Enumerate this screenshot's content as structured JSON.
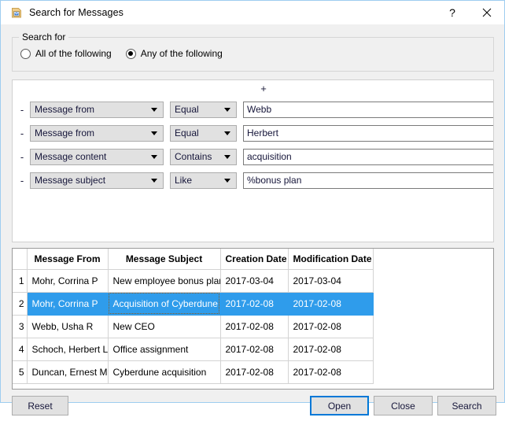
{
  "window": {
    "title": "Search for Messages",
    "icon": "message-document-icon",
    "help_label": "?",
    "close_label": "✕",
    "border_color": "#9ecdf0",
    "accent_color": "#0078d7",
    "selection_color": "#2f9ceb"
  },
  "search_for_group": {
    "legend": "Search for",
    "options": [
      {
        "label": "All of the following",
        "checked": false
      },
      {
        "label": "Any of the following",
        "checked": true
      }
    ]
  },
  "criteria": {
    "add_label": "+",
    "remove_label": "-",
    "rows": [
      {
        "field": "Message from",
        "operator": "Equal",
        "value": "Webb"
      },
      {
        "field": "Message from",
        "operator": "Equal",
        "value": "Herbert"
      },
      {
        "field": "Message content",
        "operator": "Contains",
        "value": "acquisition"
      },
      {
        "field": "Message subject",
        "operator": "Like",
        "value": "%bonus plan"
      }
    ]
  },
  "results": {
    "columns": [
      "",
      "Message From",
      "Message Subject",
      "Creation Date",
      "Modification Date"
    ],
    "rows": [
      {
        "num": "1",
        "from": "Mohr, Corrina P",
        "subject": "New employee bonus plan",
        "creation": "2017-03-04",
        "modification": "2017-03-04",
        "selected": false,
        "focused_cell": false
      },
      {
        "num": "2",
        "from": "Mohr, Corrina P",
        "subject": "Acquisition of Cyberdune",
        "creation": "2017-02-08",
        "modification": "2017-02-08",
        "selected": true,
        "focused_cell": true
      },
      {
        "num": "3",
        "from": "Webb, Usha R",
        "subject": "New CEO",
        "creation": "2017-02-08",
        "modification": "2017-02-08",
        "selected": false,
        "focused_cell": false
      },
      {
        "num": "4",
        "from": "Schoch, Herbert L",
        "subject": "Office assignment",
        "creation": "2017-02-08",
        "modification": "2017-02-08",
        "selected": false,
        "focused_cell": false
      },
      {
        "num": "5",
        "from": "Duncan, Ernest M",
        "subject": "Cyberdune acquisition",
        "creation": "2017-02-08",
        "modification": "2017-02-08",
        "selected": false,
        "focused_cell": false
      }
    ]
  },
  "footer": {
    "reset_label": "Reset",
    "open_label": "Open",
    "close_label": "Close",
    "search_label": "Search"
  }
}
